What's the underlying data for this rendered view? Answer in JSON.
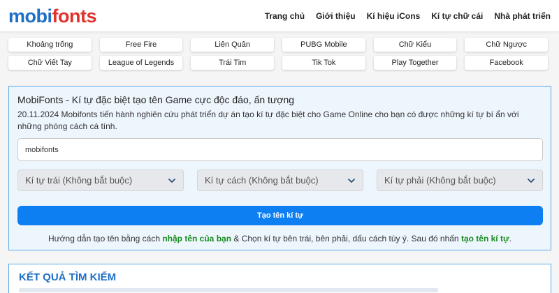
{
  "header": {
    "logo_part1": "mobi",
    "logo_part2": "fonts",
    "nav": [
      "Trang chủ",
      "Giới thiệu",
      "Kí hiệu iCons",
      "Kí tự chữ cái",
      "Nhà phát triển"
    ]
  },
  "categories": [
    "Khoảng trống",
    "Free Fire",
    "Liên Quân",
    "PUBG Mobile",
    "Chữ Kiểu",
    "Chữ Ngược",
    "Chữ Viết Tay",
    "League of Legends",
    "Trái Tim",
    "Tik Tok",
    "Play Together",
    "Facebook"
  ],
  "panel": {
    "title": "MobiFonts - Kí tự đặc biệt tạo tên Game cực độc đáo, ấn tượng",
    "desc": "20.11.2024 Mobifonts tiến hành nghiên cứu phát triển dự án tạo kí tự đặc biệt cho Game Online cho bạn có được những kí tự bí ẩn với những phóng cách cá tính.",
    "input_value": "mobifonts",
    "select_left": "Kí tự trái (Không bắt buộc)",
    "select_middle": "Kí tự cách (Không bắt buộc)",
    "select_right": "Kí tự phải (Không bắt buộc)",
    "button_label": "Tạo tên kí tự",
    "guide_part1": "Hướng dẫn tạo tên bằng cách ",
    "guide_hl1": "nhập tên của bạn",
    "guide_part2": " & Chọn kí tự bên trái, bên phải, dấu cách tùy ý. Sau đó nhấn ",
    "guide_hl2": "tạo tên kí tự",
    "guide_part3": "."
  },
  "results": {
    "title": "KẾT QUẢ TÌM KIẾM"
  },
  "colors": {
    "brand_blue": "#1f6fc5",
    "brand_red": "#e0322d",
    "button": "#0d7ff2",
    "highlight": "#178b1f"
  }
}
